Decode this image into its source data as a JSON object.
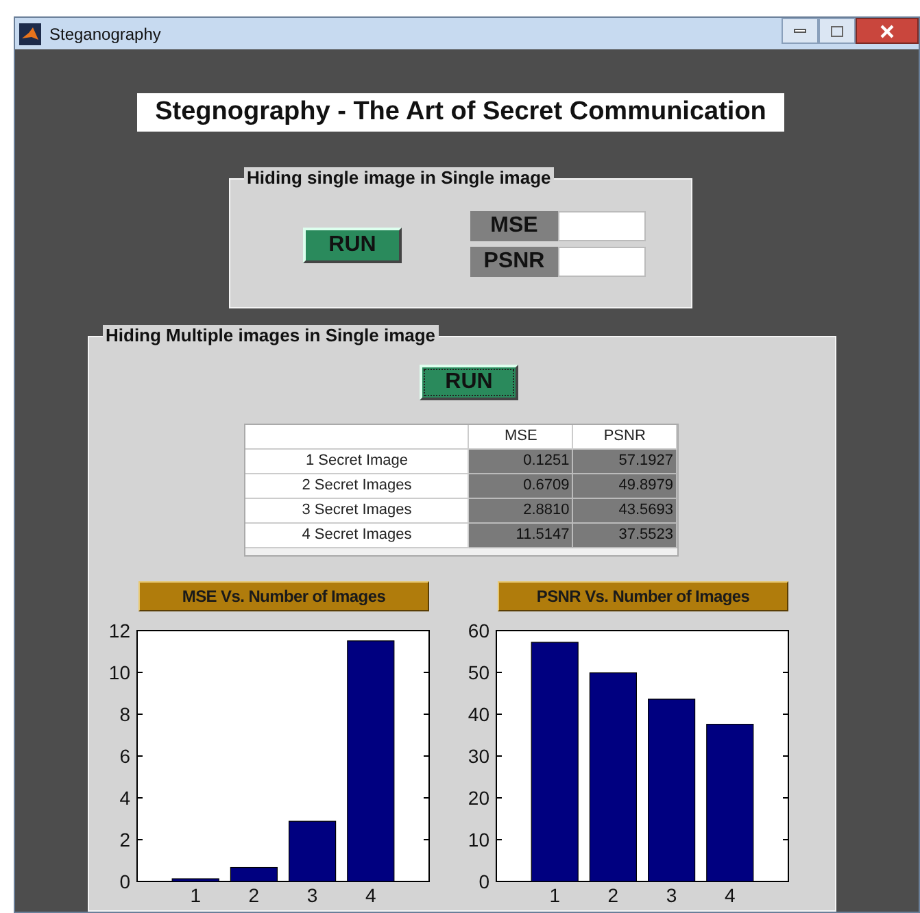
{
  "window": {
    "title": "Steganography"
  },
  "heading": "Stegnography - The Art of Secret Communication",
  "single_panel": {
    "title": "Hiding single image in Single image",
    "run_button": "RUN",
    "mse_label": "MSE",
    "psnr_label": "PSNR"
  },
  "multiple_panel": {
    "title": "Hiding Multiple images in Single image",
    "run_button": "RUN",
    "table": {
      "columns": [
        "",
        "MSE",
        "PSNR"
      ],
      "rows": [
        [
          "1 Secret Image",
          "0.1251",
          "57.1927"
        ],
        [
          "2 Secret Images",
          "0.6709",
          "49.8979"
        ],
        [
          "3 Secret Images",
          "2.8810",
          "43.5693"
        ],
        [
          "4 Secret Images",
          "11.5147",
          "37.5523"
        ]
      ]
    },
    "charts": [
      {
        "chart_data": {
          "type": "bar",
          "title": "MSE Vs. Number of Images",
          "categories": [
            "1",
            "2",
            "3",
            "4"
          ],
          "series": [
            {
              "color": "#000080",
              "values": [
                0.13,
                0.67,
                2.88,
                11.51
              ]
            }
          ],
          "ylim": [
            0,
            12
          ],
          "yticks": [
            0,
            2,
            4,
            6,
            8,
            10,
            12
          ]
        }
      },
      {
        "chart_data": {
          "type": "bar",
          "title": "PSNR Vs. Number of Images",
          "categories": [
            "1",
            "2",
            "3",
            "4"
          ],
          "series": [
            {
              "color": "#000080",
              "values": [
                57.2,
                49.9,
                43.6,
                37.6
              ]
            }
          ],
          "ylim": [
            0,
            60
          ],
          "yticks": [
            0,
            10,
            20,
            30,
            40,
            50,
            60
          ]
        }
      }
    ]
  }
}
